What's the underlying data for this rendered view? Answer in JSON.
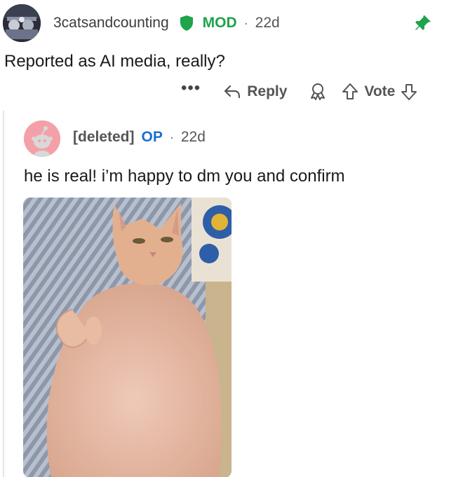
{
  "comment": {
    "username": "3catsandcounting",
    "mod_label": "MOD",
    "separator": "·",
    "age": "22d",
    "body": "Reported as AI media, really?",
    "actions": {
      "more": "•••",
      "reply_label": "Reply",
      "vote_label": "Vote"
    },
    "icons": [
      "avatar",
      "shield-icon",
      "pin-icon",
      "more-icon",
      "reply-arrow-icon",
      "award-icon",
      "upvote-icon",
      "downvote-icon"
    ]
  },
  "reply": {
    "username": "[deleted]",
    "op_label": "OP",
    "separator": "·",
    "age": "22d",
    "body": "he is real! i’m happy to dm you and confirm",
    "image": "photo of a hairless sphynx cat lying on its back"
  },
  "colors": {
    "mod_green": "#1fa34b",
    "op_blue": "#1b6fd1",
    "avatar_pink": "#f4a0a8",
    "text": "#1a1a1b",
    "muted": "#555555"
  }
}
